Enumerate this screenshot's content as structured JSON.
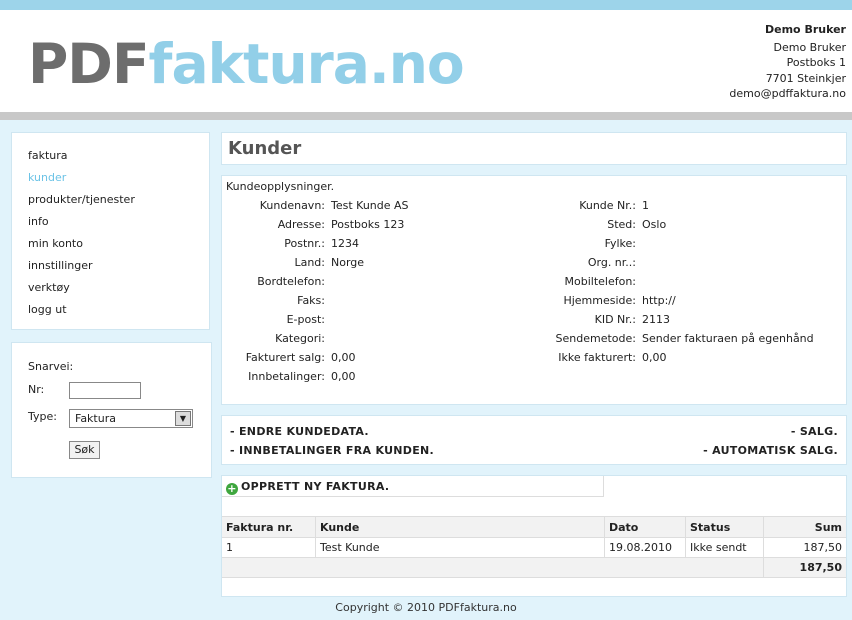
{
  "logo": {
    "part1": "PDF",
    "part2": "faktura.no"
  },
  "user": {
    "name": "Demo Bruker",
    "line1": "Demo Bruker",
    "line2": "Postboks 1",
    "line3": "7701 Steinkjer",
    "email": "demo@pdffaktura.no"
  },
  "nav": [
    {
      "label": "faktura"
    },
    {
      "label": "kunder"
    },
    {
      "label": "produkter/tjenester"
    },
    {
      "label": "info"
    },
    {
      "label": "min konto"
    },
    {
      "label": "innstillinger"
    },
    {
      "label": "verktøy"
    },
    {
      "label": "logg ut"
    }
  ],
  "shortcut": {
    "title": "Snarvei:",
    "nr_label": "Nr:",
    "nr_value": "",
    "type_label": "Type:",
    "type_value": "Faktura",
    "button": "Søk"
  },
  "page_title": "Kunder",
  "customer": {
    "heading": "Kundeopplysninger.",
    "left": [
      {
        "key": "Kundenavn:",
        "val": "Test Kunde AS"
      },
      {
        "key": "Adresse:",
        "val": "Postboks 123"
      },
      {
        "key": "Postnr.:",
        "val": "1234"
      },
      {
        "key": "Land:",
        "val": "Norge"
      },
      {
        "key": "Bordtelefon:",
        "val": ""
      },
      {
        "key": "Faks:",
        "val": ""
      },
      {
        "key": "E-post:",
        "val": ""
      },
      {
        "key": "Kategori:",
        "val": ""
      },
      {
        "key": "Fakturert salg:",
        "val": "0,00"
      },
      {
        "key": "Innbetalinger:",
        "val": "0,00"
      }
    ],
    "right": [
      {
        "key": "Kunde Nr.:",
        "val": "1"
      },
      {
        "key": "Sted:",
        "val": "Oslo"
      },
      {
        "key": "Fylke:",
        "val": ""
      },
      {
        "key": "Org. nr..:",
        "val": ""
      },
      {
        "key": "Mobiltelefon:",
        "val": ""
      },
      {
        "key": "Hjemmeside:",
        "val": "http://"
      },
      {
        "key": "KID Nr.:",
        "val": "2113"
      },
      {
        "key": "Sendemetode:",
        "val": "Sender fakturaen på egenhånd"
      },
      {
        "key": "Ikke fakturert:",
        "val": "0,00"
      }
    ]
  },
  "actions": {
    "edit": "- ENDRE KUNDEDATA.",
    "payments": "- INNBETALINGER FRA KUNDEN.",
    "sales": "- SALG.",
    "auto_sales": "- AUTOMATISK SALG."
  },
  "invoices": {
    "create": "OPPRETT NY FAKTURA.",
    "columns": [
      "Faktura nr.",
      "Kunde",
      "Dato",
      "Status",
      "Sum"
    ],
    "rows": [
      [
        "1",
        "Test Kunde",
        "19.08.2010",
        "Ikke sendt",
        "187,50"
      ]
    ],
    "total": "187,50"
  },
  "footer": "Copyright © 2010 PDFfaktura.no",
  "colors": {
    "accent": "#92cfe8",
    "logo_gray": "#6d6d6d",
    "background": "#e1f3fb",
    "active_nav": "#6cc3e6"
  }
}
